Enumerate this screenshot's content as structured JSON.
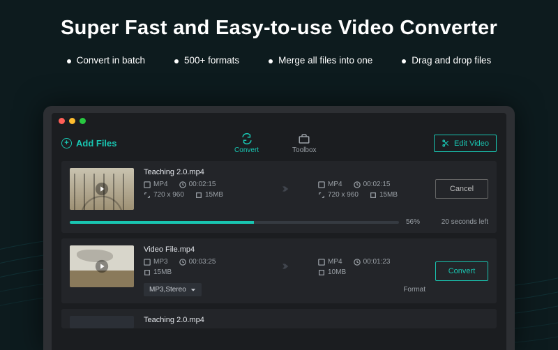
{
  "hero": {
    "title": "Super Fast and Easy-to-use Video Converter",
    "features": [
      "Convert in batch",
      "500+ formats",
      "Merge all files into one",
      "Drag and drop files"
    ]
  },
  "toolbar": {
    "add_files": "Add Files",
    "tabs": {
      "convert": "Convert",
      "toolbox": "Toolbox"
    },
    "edit_video": "Edit Video"
  },
  "rows": [
    {
      "filename": "Teaching 2.0.mp4",
      "source": {
        "format": "MP4",
        "duration": "00:02:15",
        "resolution": "720 x 960",
        "size": "15MB"
      },
      "target": {
        "format": "MP4",
        "duration": "00:02:15",
        "resolution": "720 x 960",
        "size": "15MB"
      },
      "action": "Cancel",
      "progress": {
        "percent": 56,
        "eta": "20 seconds left"
      }
    },
    {
      "filename": "Video File.mp4",
      "source": {
        "format": "MP3",
        "duration": "00:03:25",
        "size": "15MB"
      },
      "target": {
        "format": "MP4",
        "duration": "00:01:23",
        "size": "10MB"
      },
      "action": "Convert",
      "dropdown": "MP3,Stereo",
      "format_label": "Format"
    },
    {
      "filename": "Teaching 2.0.mp4"
    }
  ]
}
